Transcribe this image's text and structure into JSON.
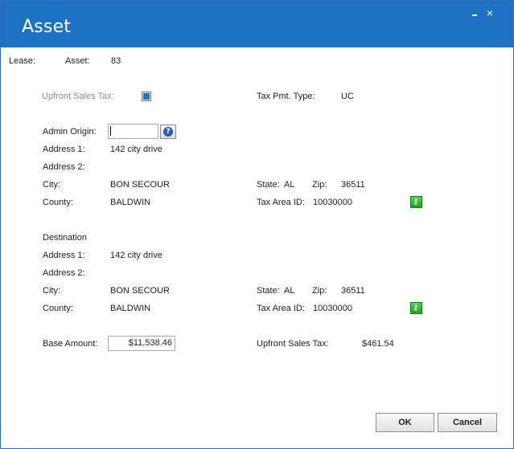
{
  "window": {
    "title": "Asset",
    "minimize_glyph": "_",
    "close_glyph": "×",
    "accent_color": "#1e72c3"
  },
  "header": {
    "lease_label": "Lease:",
    "asset_label": "Asset:",
    "asset_value": "83"
  },
  "tax": {
    "upfront_label": "Upfront Sales Tax:",
    "upfront_checked": true,
    "pmt_type_label": "Tax Pmt. Type:",
    "pmt_type_value": "UC"
  },
  "admin_origin": {
    "label": "Admin Origin:",
    "input_value": "",
    "help_icon": "help-icon",
    "address1_label": "Address 1:",
    "address1_value": "142 city drive",
    "address2_label": "Address 2:",
    "city_label": "City:",
    "city_value": "BON SECOUR",
    "state_label": "State:",
    "state_value": "AL",
    "zip_label": "Zip:",
    "zip_value": "36511",
    "county_label": "County:",
    "county_value": "BALDWIN",
    "tax_area_label": "Tax Area ID:",
    "tax_area_value": "10030000",
    "lookup_icon": "key-icon"
  },
  "destination": {
    "heading": "Destination",
    "address1_label": "Address 1:",
    "address1_value": "142 city drive",
    "address2_label": "Address 2:",
    "city_label": "City:",
    "city_value": "BON SECOUR",
    "state_label": "State:",
    "state_value": "AL",
    "zip_label": "Zip:",
    "zip_value": "36511",
    "county_label": "County:",
    "county_value": "BALDWIN",
    "tax_area_label": "Tax Area ID:",
    "tax_area_value": "10030000",
    "lookup_icon": "key-icon"
  },
  "amounts": {
    "base_label": "Base Amount:",
    "base_value": "$11,538.46",
    "upfront_tax_label": "Upfront Sales Tax:",
    "upfront_tax_value": "$461.54"
  },
  "buttons": {
    "ok": "OK",
    "cancel": "Cancel"
  }
}
